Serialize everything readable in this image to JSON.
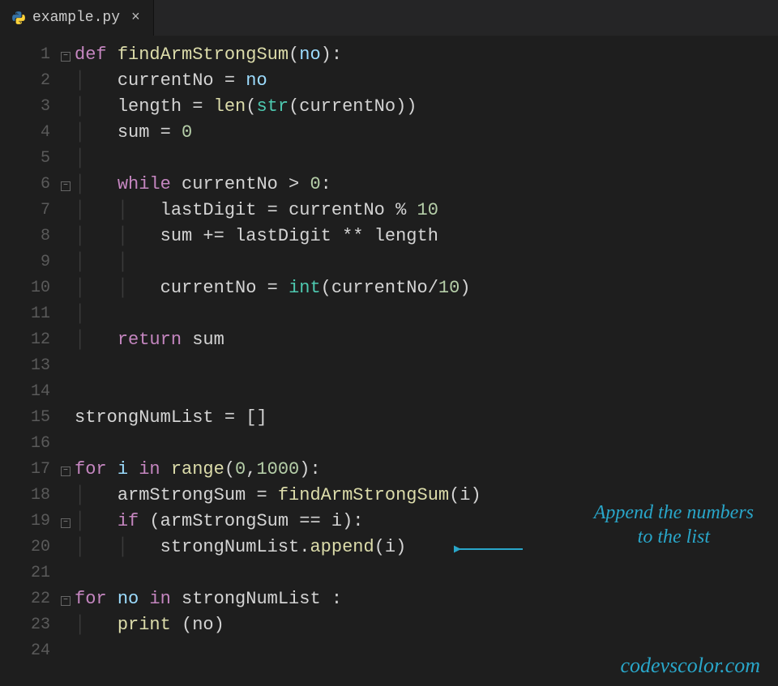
{
  "tab": {
    "filename": "example.py"
  },
  "fold_lines": [
    1,
    6,
    17,
    19,
    22
  ],
  "line_numbers": [
    1,
    2,
    3,
    4,
    5,
    6,
    7,
    8,
    9,
    10,
    11,
    12,
    13,
    14,
    15,
    16,
    17,
    18,
    19,
    20,
    21,
    22,
    23,
    24
  ],
  "code": {
    "l1": {
      "kw": "def",
      "fn": "findArmStrongSum",
      "p0": "(",
      "prm": "no",
      "p1": "):"
    },
    "l2": {
      "var": "currentNo",
      "eq": " = ",
      "prm": "no"
    },
    "l3": {
      "var": "length",
      "eq": " = ",
      "fn": "len",
      "p0": "(",
      "call": "str",
      "p1": "(",
      "var2": "currentNo",
      "p2": "))"
    },
    "l4": {
      "var": "sum",
      "eq": " = ",
      "num": "0"
    },
    "l6": {
      "kw": "while",
      "sp": " ",
      "var": "currentNo",
      "op": " > ",
      "num": "0",
      "colon": ":"
    },
    "l7": {
      "var": "lastDigit",
      "eq": " = ",
      "var2": "currentNo",
      "op": " % ",
      "num": "10"
    },
    "l8": {
      "var": "sum",
      "op": " += ",
      "var2": "lastDigit",
      "op2": " ** ",
      "var3": "length"
    },
    "l10": {
      "var": "currentNo",
      "eq": " = ",
      "call": "int",
      "p0": "(",
      "var2": "currentNo",
      "op": "/",
      "num": "10",
      "p1": ")"
    },
    "l12": {
      "kw": "return",
      "sp": " ",
      "var": "sum"
    },
    "l15": {
      "var": "strongNumList",
      "eq": " = []"
    },
    "l17": {
      "kw": "for",
      "sp": " ",
      "prm": "i",
      "sp2": " ",
      "kw2": "in",
      "sp3": " ",
      "fn": "range",
      "p0": "(",
      "num": "0",
      "comma": ",",
      "num2": "1000",
      "p1": "):"
    },
    "l18": {
      "var": "armStrongSum",
      "eq": " = ",
      "fn": "findArmStrongSum",
      "p0": "(",
      "var2": "i",
      "p1": ")"
    },
    "l19": {
      "kw": "if",
      "sp": " (",
      "var": "armStrongSum",
      "op": " == ",
      "var2": "i",
      "p1": "):"
    },
    "l20": {
      "var": "strongNumList",
      "dot": ".",
      "fn": "append",
      "p0": "(",
      "var2": "i",
      "p1": ")"
    },
    "l22": {
      "kw": "for",
      "sp": " ",
      "prm": "no",
      "sp2": " ",
      "kw2": "in",
      "sp3": " ",
      "var": "strongNumList",
      "colon": " :"
    },
    "l23": {
      "fn": "print",
      "sp": " (",
      "var": "no",
      "p1": ")"
    }
  },
  "annotation": {
    "line1": "Append the numbers",
    "line2": "to the list"
  },
  "watermark": "codevscolor.com"
}
